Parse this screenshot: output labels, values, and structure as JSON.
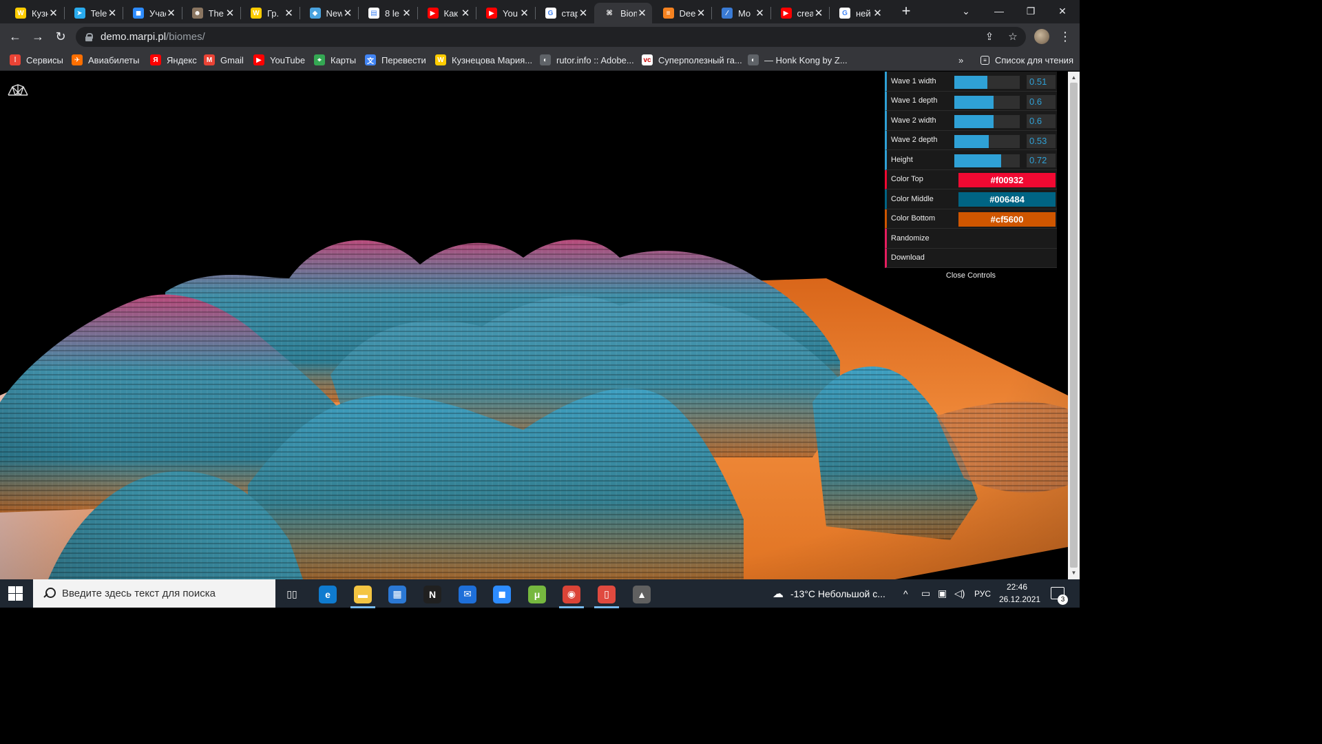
{
  "tabs": [
    {
      "title": "Кузнецова",
      "icon": "yandex-music-icon",
      "color": "#ffcc00",
      "glyph": "W"
    },
    {
      "title": "Telegram",
      "icon": "telegram-icon",
      "color": "#2aabee",
      "glyph": "➤"
    },
    {
      "title": "Участники",
      "icon": "zoom-icon",
      "color": "#2d8cff",
      "glyph": "◼"
    },
    {
      "title": "The",
      "icon": "person-icon",
      "color": "#8a7560",
      "glyph": "☻"
    },
    {
      "title": "Гр.",
      "icon": "yandex-music-icon",
      "color": "#ffcc00",
      "glyph": "W"
    },
    {
      "title": "New",
      "icon": "cube-icon",
      "color": "#4aa3df",
      "glyph": "◆"
    },
    {
      "title": "8 le",
      "icon": "news-icon",
      "color": "#ffffff",
      "glyph": "▤"
    },
    {
      "title": "Как",
      "icon": "youtube-icon",
      "color": "#ff0000",
      "glyph": "▶"
    },
    {
      "title": "You",
      "icon": "youtube-icon",
      "color": "#ff0000",
      "glyph": "▶"
    },
    {
      "title": "стар",
      "icon": "google-icon",
      "color": "#ffffff",
      "glyph": "G"
    },
    {
      "title": "Biomes",
      "icon": "biomes-icon",
      "color": "#35363a",
      "glyph": "⌘",
      "active": true
    },
    {
      "title": "Dee",
      "icon": "deep-icon",
      "color": "#f58220",
      "glyph": "≡"
    },
    {
      "title": "Mo",
      "icon": "mo-icon",
      "color": "#3a7bd5",
      "glyph": "∕"
    },
    {
      "title": "crea",
      "icon": "youtube-icon",
      "color": "#ff0000",
      "glyph": "▶"
    },
    {
      "title": "ней",
      "icon": "google-icon",
      "color": "#ffffff",
      "glyph": "G"
    }
  ],
  "browser": {
    "url_host": "demo.marpi.pl",
    "url_path": "/biomes/"
  },
  "bookmarks": [
    {
      "label": "Сервисы",
      "icon": "apps-grid-icon",
      "color": "#ea4335",
      "glyph": "⁞"
    },
    {
      "label": "Авиабилеты",
      "icon": "aviasales-icon",
      "color": "#ff6f00",
      "glyph": "✈"
    },
    {
      "label": "Яндекс",
      "icon": "yandex-icon",
      "color": "#ff0000",
      "glyph": "Я"
    },
    {
      "label": "Gmail",
      "icon": "gmail-icon",
      "color": "#ea4335",
      "glyph": "M"
    },
    {
      "label": "YouTube",
      "icon": "youtube-icon",
      "color": "#ff0000",
      "glyph": "▶"
    },
    {
      "label": "Карты",
      "icon": "maps-icon",
      "color": "#34a853",
      "glyph": "⌖"
    },
    {
      "label": "Перевести",
      "icon": "translate-icon",
      "color": "#4285f4",
      "glyph": "文"
    },
    {
      "label": "Кузнецова Мария...",
      "icon": "yandex-music-icon",
      "color": "#ffcc00",
      "glyph": "W"
    },
    {
      "label": "rutor.info :: Adobe...",
      "icon": "globe-icon",
      "color": "#5f6368",
      "glyph": "◐"
    },
    {
      "label": "Суперполезный га...",
      "icon": "vc-icon",
      "color": "#ffffff",
      "glyph": "vc"
    },
    {
      "label": "— Honk Kong by Z...",
      "icon": "globe-icon",
      "color": "#5f6368",
      "glyph": "◐"
    }
  ],
  "reading_list": {
    "label": "Список для чтения"
  },
  "controls": {
    "sliders": [
      {
        "label": "Wave 1 width",
        "value": "0.51",
        "fraction": 0.51
      },
      {
        "label": "Wave 1 depth",
        "value": "0.6",
        "fraction": 0.6
      },
      {
        "label": "Wave 2 width",
        "value": "0.6",
        "fraction": 0.6
      },
      {
        "label": "Wave 2 depth",
        "value": "0.53",
        "fraction": 0.53
      },
      {
        "label": "Height",
        "value": "0.72",
        "fraction": 0.72
      }
    ],
    "colors": [
      {
        "label": "Color Top",
        "value": "#f00932"
      },
      {
        "label": "Color Middle",
        "value": "#006484"
      },
      {
        "label": "Color Bottom",
        "value": "#cf5600"
      }
    ],
    "actions": [
      "Randomize",
      "Download"
    ],
    "close_label": "Close Controls"
  },
  "taskbar": {
    "search_placeholder": "Введите здесь текст для поиска",
    "apps": [
      {
        "name": "task-view",
        "color": "#1f2731",
        "glyph": "▯▯",
        "running": false
      },
      {
        "name": "edge",
        "color": "#0f7bcf",
        "glyph": "e",
        "running": false
      },
      {
        "name": "file-explorer",
        "color": "#f4c542",
        "glyph": "▬",
        "running": true
      },
      {
        "name": "microsoft-store",
        "color": "#2b78d4",
        "glyph": "▦",
        "running": false
      },
      {
        "name": "notion",
        "color": "#202020",
        "glyph": "N",
        "running": false
      },
      {
        "name": "mail",
        "color": "#1e6fd9",
        "glyph": "✉",
        "running": false
      },
      {
        "name": "zoom",
        "color": "#2d8cff",
        "glyph": "◼",
        "running": false
      },
      {
        "name": "utorrent",
        "color": "#76b83f",
        "glyph": "μ",
        "running": false
      },
      {
        "name": "chrome",
        "color": "#db4437",
        "glyph": "◉",
        "running": true
      },
      {
        "name": "phone-app",
        "color": "#e04a3f",
        "glyph": "▯",
        "running": true
      },
      {
        "name": "inkscape",
        "color": "#606060",
        "glyph": "▲",
        "running": false
      }
    ],
    "weather": "-13°C  Небольшой с...",
    "language": "РУС",
    "time": "22:46",
    "date": "26.12.2021",
    "notification_count": "3"
  }
}
